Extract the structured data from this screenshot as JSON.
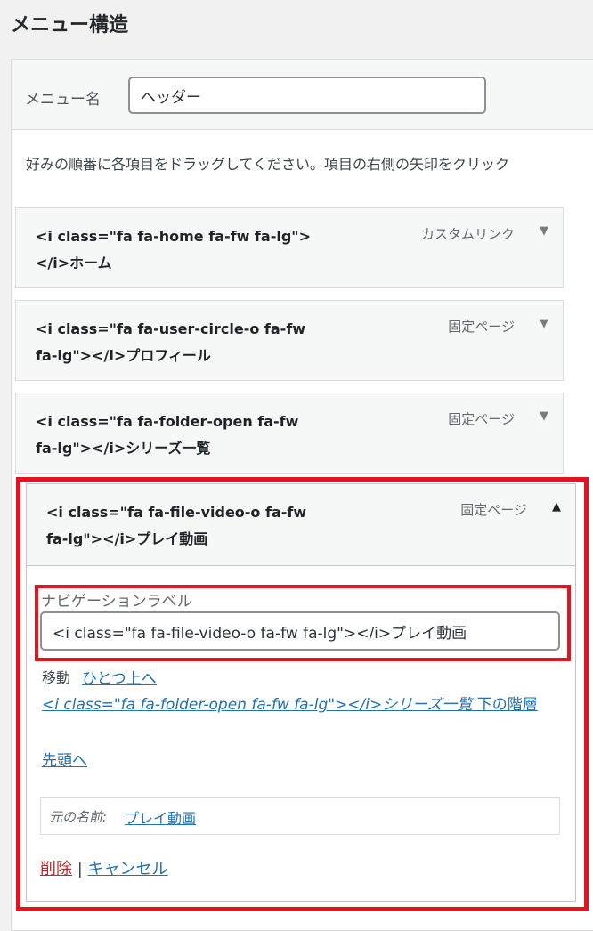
{
  "page": {
    "title": "メニュー構造"
  },
  "menu_name": {
    "label": "メニュー名",
    "value": "ヘッダー"
  },
  "instructions": "好みの順番に各項目をドラッグしてください。項目の右側の矢印をクリック",
  "menu_items": [
    {
      "title": "<i class=\"fa fa-home fa-fw fa-lg\"></i>ホーム",
      "type": "カスタムリンク",
      "toggle_icon": "triangle-down"
    },
    {
      "title": "<i class=\"fa fa-user-circle-o fa-fw fa-lg\"></i>プロフィール",
      "type": "固定ページ",
      "toggle_icon": "triangle-down"
    },
    {
      "title": "<i class=\"fa fa-folder-open fa-fw fa-lg\"></i>シリーズ一覧",
      "type": "固定ページ",
      "toggle_icon": "triangle-down"
    }
  ],
  "active_item": {
    "title": "<i class=\"fa fa-file-video-o fa-fw fa-lg\"></i>プレイ動画",
    "type": "固定ページ",
    "toggle_icon": "triangle-up",
    "nav_label": {
      "label": "ナビゲーションラベル",
      "value": "<i class=\"fa fa-file-video-o fa-fw fa-lg\"></i>プレイ動画"
    },
    "move": {
      "label": "移動",
      "up_one": "ひとつ上へ",
      "under_item": "<i class=\"fa fa-folder-open fa-fw fa-lg\"></i>シリーズ一覧",
      "under_suffix": " 下の階層",
      "to_top": "先頭へ"
    },
    "original": {
      "label": "元の名前:",
      "link": "プレイ動画"
    },
    "actions": {
      "delete": "削除",
      "separator": "|",
      "cancel": "キャンセル"
    }
  },
  "colors": {
    "highlight": "#e31320",
    "link": "#2271b1",
    "delete": "#b32d2e"
  }
}
